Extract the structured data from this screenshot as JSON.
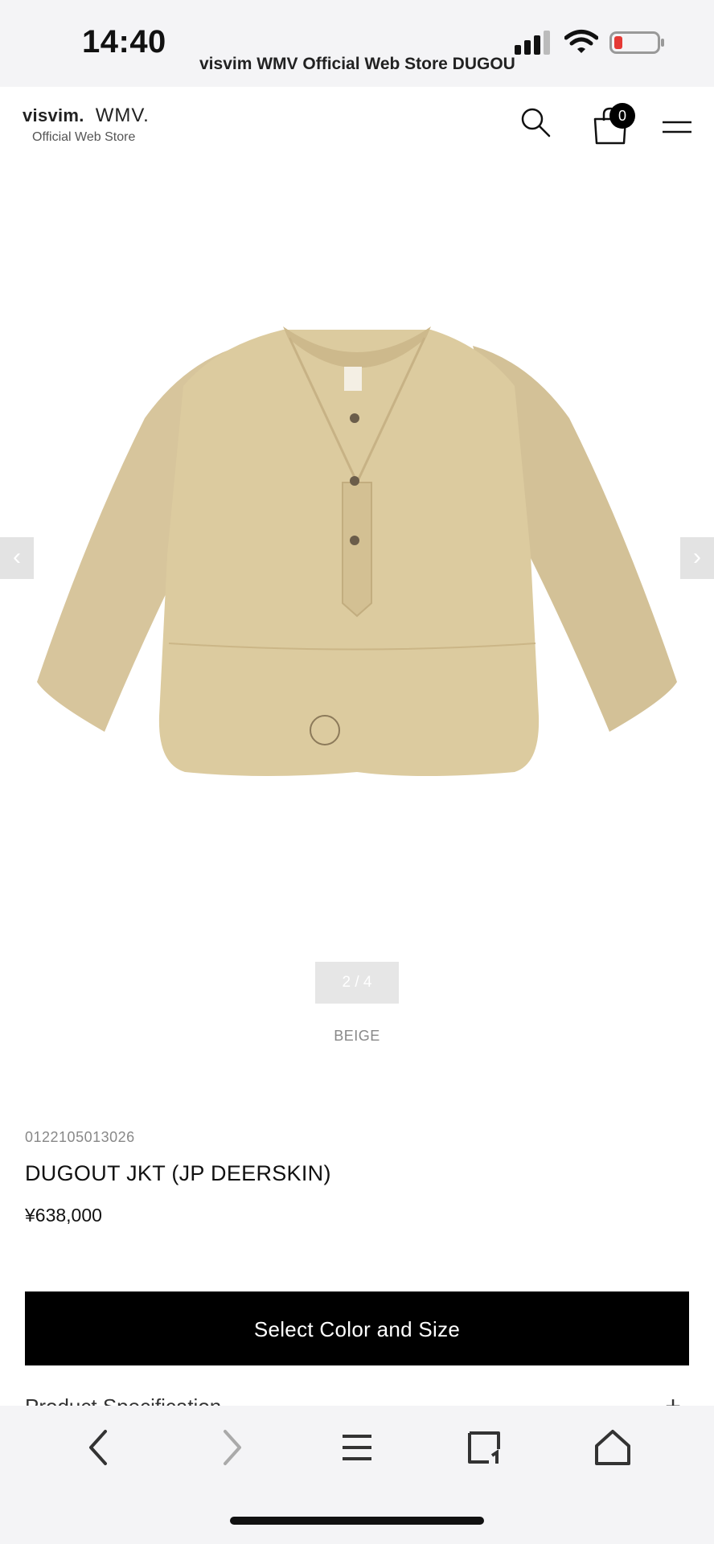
{
  "status": {
    "time": "14:40",
    "battery_color": "#e53935"
  },
  "browser": {
    "page_title": "visvim WMV Official Web Store DUGOUT JKT (JP DEERSKIN)"
  },
  "header": {
    "logo_brand": "visvim.",
    "logo_sub_brand": "WMV.",
    "logo_tagline": "Official Web Store",
    "cart_count": "0",
    "icons": [
      "search-icon",
      "shopping-bag-icon",
      "menu-icon"
    ]
  },
  "gallery": {
    "prev_arrow": "‹",
    "next_arrow": "›",
    "pager": "2 / 4",
    "color": "BEIGE",
    "image_subject": "beige deerskin pullover jacket"
  },
  "product": {
    "code": "0122105013026",
    "title": "DUGOUT JKT (JP DEERSKIN)",
    "price": "¥638,000",
    "cta_label": "Select Color and Size",
    "spec_label": "Product Specification",
    "spec_toggle": "+"
  },
  "toolbar": {
    "icons": [
      "back-icon",
      "forward-icon",
      "menu-lines-icon",
      "tabs-icon",
      "home-icon"
    ]
  },
  "colors": {
    "primary_button": "#000000",
    "muted_text": "#888888",
    "jacket": "#d9c8a1"
  }
}
